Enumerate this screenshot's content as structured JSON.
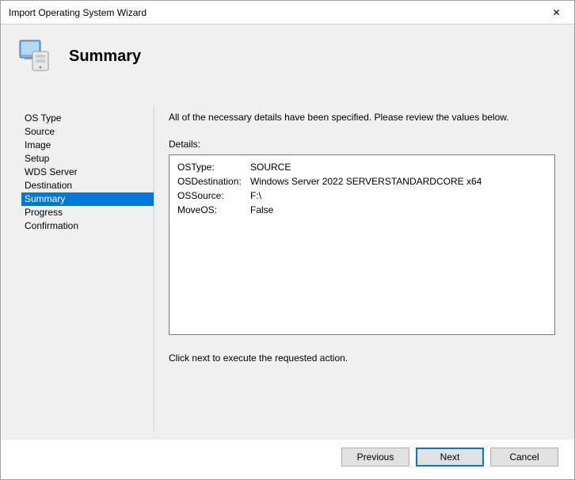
{
  "window": {
    "title": "Import Operating System Wizard",
    "close": "✕"
  },
  "header": {
    "title": "Summary"
  },
  "sidebar": {
    "items": [
      {
        "label": "OS Type"
      },
      {
        "label": "Source"
      },
      {
        "label": "Image"
      },
      {
        "label": "Setup"
      },
      {
        "label": "WDS Server"
      },
      {
        "label": "Destination"
      },
      {
        "label": "Summary"
      },
      {
        "label": "Progress"
      },
      {
        "label": "Confirmation"
      }
    ],
    "selectedIndex": 6
  },
  "content": {
    "intro": "All of the necessary details have been specified.  Please review the values below.",
    "detailsLabel": "Details:",
    "details": [
      {
        "key": "OSType:",
        "value": "SOURCE"
      },
      {
        "key": "OSDestination:",
        "value": "Windows Server 2022 SERVERSTANDARDCORE x64"
      },
      {
        "key": "OSSource:",
        "value": "F:\\"
      },
      {
        "key": "MoveOS:",
        "value": "False"
      }
    ],
    "footer": "Click next to execute the requested action."
  },
  "buttons": {
    "previous": "Previous",
    "next": "Next",
    "cancel": "Cancel"
  }
}
